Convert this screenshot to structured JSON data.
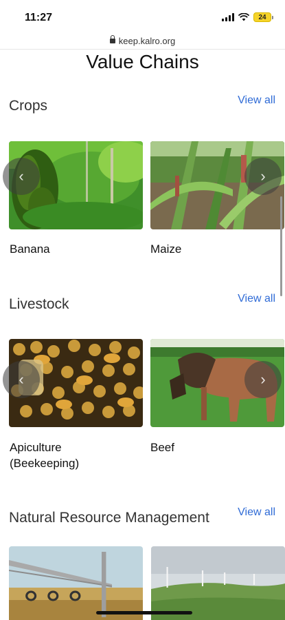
{
  "status_bar": {
    "time": "11:27",
    "battery": "24"
  },
  "browser": {
    "url": "keep.kalro.org"
  },
  "page": {
    "title": "Value Chains"
  },
  "sections": [
    {
      "title": "Crops",
      "view_all": "View all",
      "items": [
        {
          "label": "Banana"
        },
        {
          "label": "Maize"
        }
      ]
    },
    {
      "title": "Livestock",
      "view_all": "View all",
      "items": [
        {
          "label": "Apiculture (Beekeeping)"
        },
        {
          "label": "Beef"
        }
      ]
    },
    {
      "title": "Natural Resource Management",
      "view_all": "View all"
    }
  ],
  "carousel": {
    "prev_icon": "chevron-left-icon",
    "next_icon": "chevron-right-icon",
    "prev_glyph": "‹",
    "next_glyph": "›"
  },
  "colors": {
    "link": "#2f6bd6",
    "text": "#111111"
  }
}
